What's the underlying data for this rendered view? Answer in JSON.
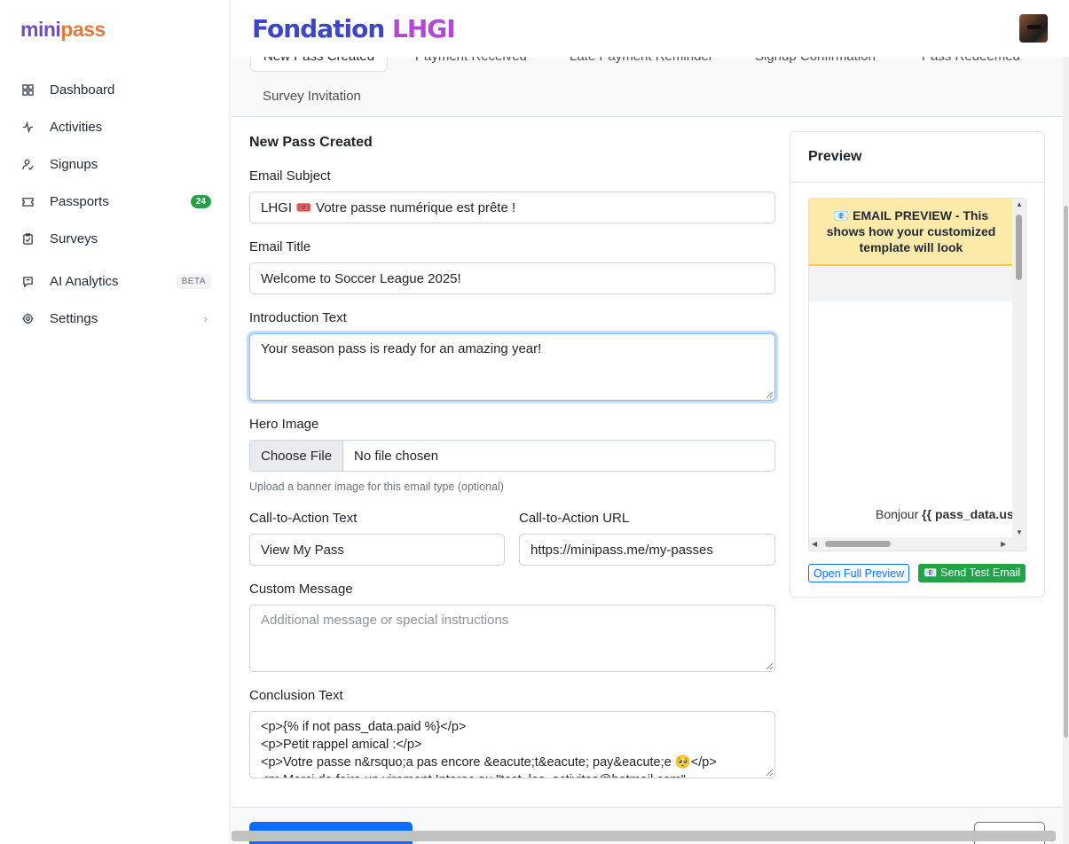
{
  "sidebar": {
    "logo_part1": "mini",
    "logo_part2": "pass",
    "items": [
      {
        "label": "Dashboard",
        "icon": "grid-icon"
      },
      {
        "label": "Activities",
        "icon": "activity-icon"
      },
      {
        "label": "Signups",
        "icon": "user-check-icon"
      },
      {
        "label": "Passports",
        "icon": "ticket-icon",
        "badge": "24"
      },
      {
        "label": "Surveys",
        "icon": "clipboard-icon"
      },
      {
        "label": "AI Analytics",
        "icon": "chat-icon",
        "badge": "BETA"
      },
      {
        "label": "Settings",
        "icon": "gear-icon",
        "chevron": "›"
      }
    ]
  },
  "header": {
    "brand_part1": "Fondation",
    "brand_part2": "LHGI"
  },
  "tabs": [
    {
      "label": "New Pass Created",
      "active": true
    },
    {
      "label": "Payment Received"
    },
    {
      "label": "Late Payment Reminder"
    },
    {
      "label": "Signup Confirmation"
    },
    {
      "label": "Pass Redeemed"
    },
    {
      "label": "Survey Invitation"
    }
  ],
  "form": {
    "section_title": "New Pass Created",
    "email_subject_label": "Email Subject",
    "email_subject_value": "LHGI 🎟️ Votre passe numérique est prête !",
    "email_title_label": "Email Title",
    "email_title_value": "Welcome to Soccer League 2025!",
    "intro_label": "Introduction Text",
    "intro_value": "Your season pass is ready for an amazing year!",
    "hero_label": "Hero Image",
    "hero_button": "Choose File",
    "hero_status": "No file chosen",
    "hero_help": "Upload a banner image for this email type (optional)",
    "cta_text_label": "Call-to-Action Text",
    "cta_text_value": "View My Pass",
    "cta_url_label": "Call-to-Action URL",
    "cta_url_value": "https://minipass.me/my-passes",
    "custom_label": "Custom Message",
    "custom_placeholder": "Additional message or special instructions",
    "conclusion_label": "Conclusion Text",
    "conclusion_lines": [
      "<p>{% if not pass_data.paid %}</p>",
      "<p>Petit rappel amical :</p>",
      "<p>Votre passe n&rsquo;a pas encore &eacute;t&eacute; pay&eacute;e 🥺</p>",
      "<p>Merci de faire un virement Interac au \"test_les_activites@hotmail.com\""
    ]
  },
  "preview": {
    "title": "Preview",
    "banner": "📧 EMAIL PREVIEW - This shows how your customized template will look",
    "greeting_prefix": "Bonjour",
    "greeting_var": "{{ pass_data.user",
    "open_button": "Open Full Preview",
    "send_button": "📧 Send Test Email"
  },
  "colors": {
    "primary": "#0d6efd",
    "success": "#22a34a",
    "brand_blue": "#3b46c9",
    "brand_purple": "#b348d8"
  }
}
